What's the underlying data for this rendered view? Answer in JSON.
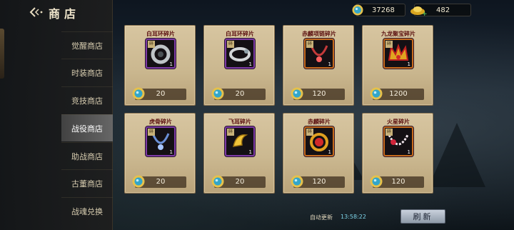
{
  "header": {
    "title": "商店",
    "back_icon": "back-arrow-icon"
  },
  "sidebar": {
    "items": [
      {
        "label": "觉醒商店",
        "active": false
      },
      {
        "label": "时装商店",
        "active": false
      },
      {
        "label": "竞技商店",
        "active": false
      },
      {
        "label": "战役商店",
        "active": true
      },
      {
        "label": "助战商店",
        "active": false
      },
      {
        "label": "古董商店",
        "active": false
      },
      {
        "label": "战魂兑换",
        "active": false
      }
    ]
  },
  "currency": {
    "gems": "37268",
    "gold": "482"
  },
  "items": [
    {
      "name": "白耳环碎片",
      "qty": "1",
      "tag": "碎",
      "price": "20",
      "icon": "silver-ring-icon",
      "frame": "purple"
    },
    {
      "name": "白耳环碎片",
      "qty": "1",
      "tag": "碎",
      "price": "20",
      "icon": "silver-bangle-icon",
      "frame": "purple"
    },
    {
      "name": "赤麟项链碎片",
      "qty": "1",
      "tag": "碎",
      "price": "120",
      "icon": "red-necklace-icon",
      "frame": "orange"
    },
    {
      "name": "九龙聚宝碎片",
      "qty": "1",
      "tag": "碎",
      "price": "1200",
      "icon": "golden-crown-icon",
      "frame": "orange"
    },
    {
      "name": "虎骨碎片",
      "qty": "1",
      "tag": "碎",
      "price": "20",
      "icon": "blue-necklace-icon",
      "frame": "purple"
    },
    {
      "name": "飞耳碎片",
      "qty": "1",
      "tag": "碎",
      "price": "20",
      "icon": "golden-horn-icon",
      "frame": "purple"
    },
    {
      "name": "赤麟碎片",
      "qty": "1",
      "tag": "碎",
      "price": "120",
      "icon": "red-ring-icon",
      "frame": "orange"
    },
    {
      "name": "火星碎片",
      "qty": "1",
      "tag": "碎",
      "price": "120",
      "icon": "pearl-necklace-icon",
      "frame": "orange"
    }
  ],
  "footer": {
    "auto_refresh_label": "自动更新",
    "auto_refresh_time": "13:58:22",
    "refresh_button": "刷新"
  }
}
